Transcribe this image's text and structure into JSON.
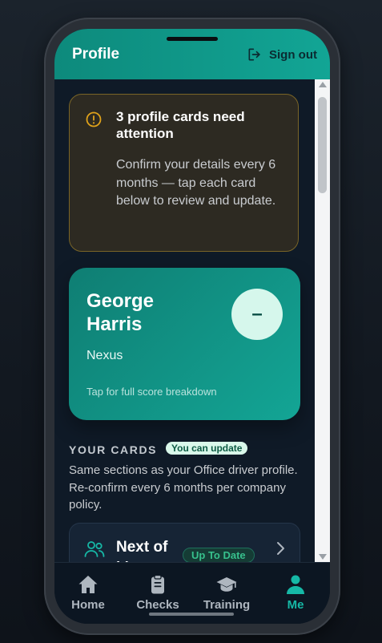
{
  "header": {
    "title": "Profile",
    "sign_out_label": "Sign out"
  },
  "alert": {
    "heading": "3 profile cards need attention",
    "body": "Confirm your details every 6 months — tap each card below to review and update."
  },
  "profile": {
    "name": "George Harris",
    "company": "Nexus",
    "score_symbol": "–",
    "hint": "Tap for full score breakdown"
  },
  "cards_section": {
    "title": "YOUR CARDS",
    "badge": "You can update",
    "description": "Same sections as your Office driver profile. Re-confirm every 6 months per company policy.",
    "items": [
      {
        "label": "Next of kin",
        "status": "Up To Date",
        "icon": "people-icon"
      }
    ]
  },
  "nav": {
    "items": [
      {
        "label": "Home",
        "icon": "home-icon"
      },
      {
        "label": "Checks",
        "icon": "clipboard-icon"
      },
      {
        "label": "Training",
        "icon": "graduation-cap-icon"
      },
      {
        "label": "Me",
        "icon": "person-icon",
        "active": true
      }
    ]
  },
  "colors": {
    "accent": "#13a595",
    "warning": "#e0a21a",
    "success": "#37c08c",
    "background": "#0f1a27"
  }
}
